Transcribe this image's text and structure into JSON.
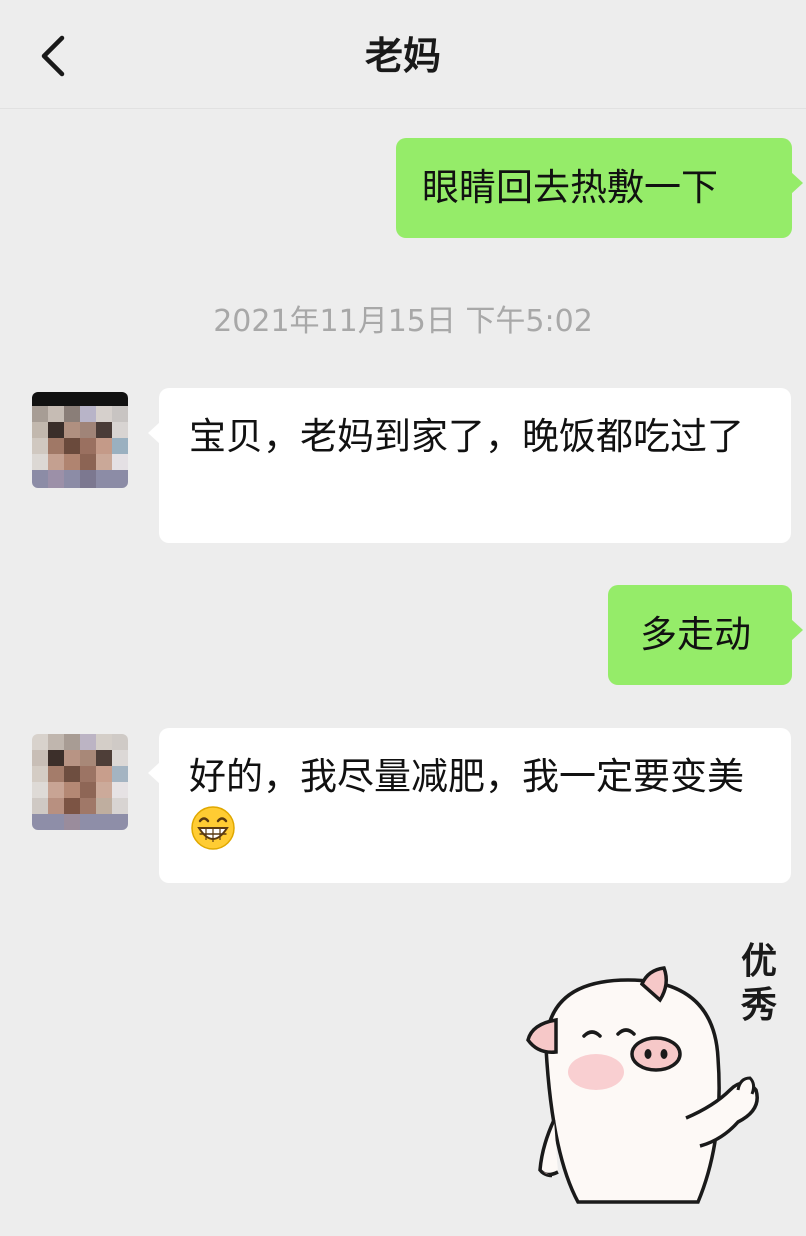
{
  "header": {
    "title": "老妈",
    "back_icon": "chevron-left-icon"
  },
  "messages": [
    {
      "side": "out",
      "text": "眼睛回去热敷一下"
    },
    {
      "side": "in",
      "text": "宝贝，老妈到家了，晚饭都吃过了"
    },
    {
      "side": "out",
      "text": "多走动"
    },
    {
      "side": "in",
      "text": "好的，我尽量减肥，我一定要变美"
    }
  ],
  "timestamp": "2021年11月15日 下午5:02",
  "sticker": {
    "icon": "pig-sticker",
    "text": "优秀"
  },
  "colors": {
    "background": "#ededed",
    "outgoing_bubble": "#95ec69",
    "incoming_bubble": "#ffffff",
    "timestamp_text": "#a8a8a8"
  }
}
